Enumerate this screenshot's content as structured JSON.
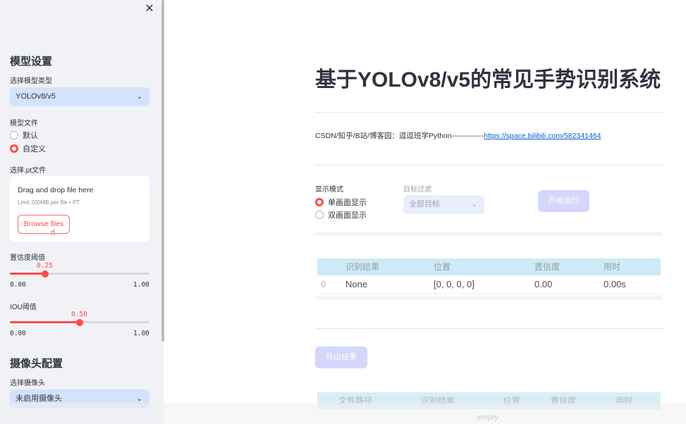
{
  "sidebar": {
    "section_model": "模型设置",
    "model_type_label": "选择模型类型",
    "model_type_value": "YOLOv8/v5",
    "model_file_label": "模型文件",
    "model_file_options": [
      "默认",
      "自定义"
    ],
    "model_file_selected": 1,
    "pt_file_label": "选择.pt文件",
    "uploader": {
      "title": "Drag and drop file here",
      "subtitle": "Limit 200MB per file • PT",
      "button": "Browse files"
    },
    "conf": {
      "label": "置信度阈值",
      "value": "0.25",
      "value_num": 0.25,
      "min": "0.00",
      "max": "1.00"
    },
    "iou": {
      "label": "IOU阈值",
      "value": "0.50",
      "value_num": 0.5,
      "min": "0.00",
      "max": "1.00"
    },
    "section_camera": "摄像头配置",
    "camera_label": "选择摄像头",
    "camera_value": "未启用摄像头"
  },
  "main": {
    "title": "基于YOLOv8/v5的常见手势识别系统",
    "credit_text": "CSDN/知乎/B站/博客园：逗逗班学Python-------------",
    "credit_link": "https://space.bilibili.com/582341464",
    "display_mode_label": "显示模式",
    "display_mode_options": [
      "单画面显示",
      "双画面显示"
    ],
    "display_mode_selected": 0,
    "target_filter_label": "目标过滤",
    "target_filter_value": "全部目标",
    "run_button": "开始运行",
    "results_table": {
      "columns": [
        "识别结果",
        "位置",
        "置信度",
        "用时"
      ],
      "rows": [
        {
          "index": "0",
          "result": "None",
          "position": "[0, 0, 0, 0]",
          "confidence": "0.00",
          "time": "0.00s"
        }
      ]
    },
    "export_button": "导出结果",
    "files_table": {
      "columns": [
        "文件路径",
        "识别结果",
        "位置",
        "置信度",
        "用时"
      ],
      "empty_text": "empty"
    }
  },
  "colors": {
    "accent": "#ff4b4b",
    "sidebar_bg": "#f0f2f6",
    "select_bg": "#d3e3fb",
    "button_disabled": "#d4d6fb",
    "link": "#0b5ccc"
  }
}
